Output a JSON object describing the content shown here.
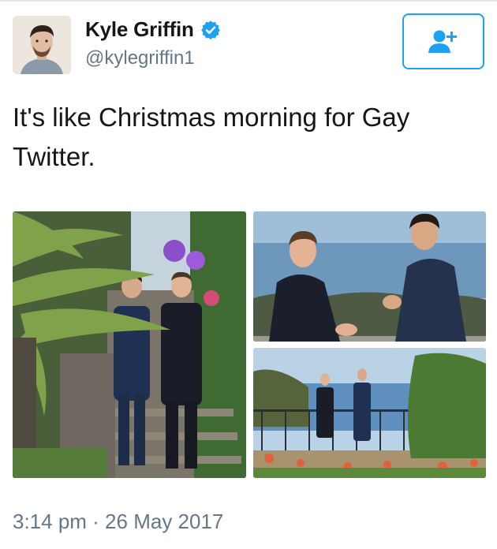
{
  "tweet": {
    "author": {
      "display_name": "Kyle Griffin",
      "handle": "@kylegriffin1",
      "verified": true,
      "avatar_icon": "profile-photo"
    },
    "follow_button_icon": "add-user-icon",
    "text": "It's like Christmas morning for Gay Twitter.",
    "timestamp": "3:14 pm · 26 May 2017",
    "media": [
      {
        "kind": "photo"
      },
      {
        "kind": "photo"
      },
      {
        "kind": "photo"
      }
    ]
  },
  "colors": {
    "accent": "#1da1f2",
    "text": "#14171a",
    "secondary_text": "#657786",
    "border": "#e1e8ed"
  }
}
